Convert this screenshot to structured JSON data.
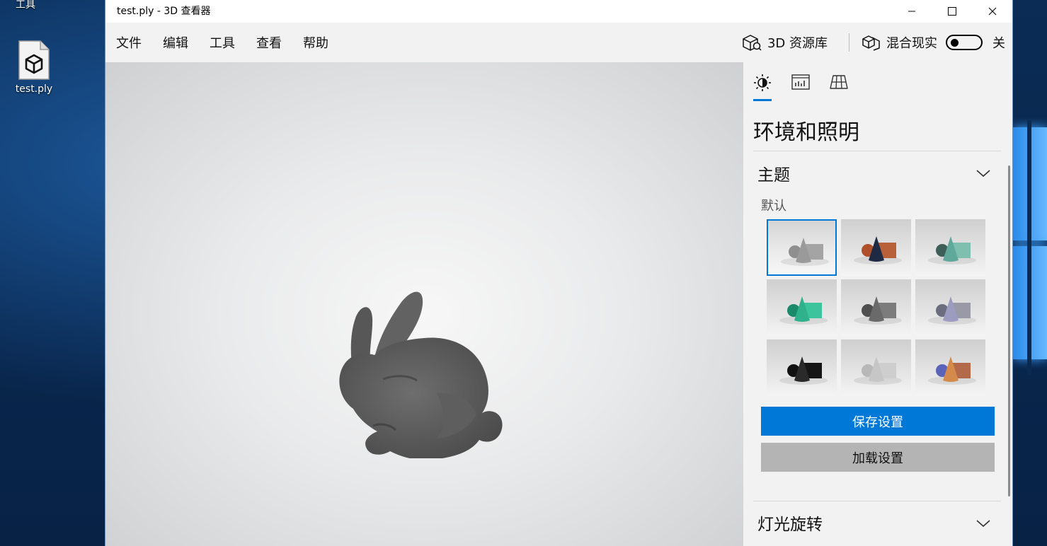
{
  "desktop": {
    "top_label": "工具",
    "file_icon_label": "test.ply"
  },
  "window": {
    "title": "test.ply - 3D 查看器",
    "controls": [
      "minimize",
      "maximize",
      "close"
    ]
  },
  "menubar": {
    "items": [
      "文件",
      "编辑",
      "工具",
      "查看",
      "帮助"
    ],
    "library_label": "3D 资源库",
    "mixed_reality_label": "混合现实",
    "toggle_state": "关"
  },
  "panel": {
    "tabs": [
      "environment-lighting-icon",
      "stats-icon",
      "grid-icon"
    ],
    "title": "环境和照明",
    "theme_section": {
      "heading": "主题",
      "selected_label": "默认",
      "themes": [
        {
          "sphere": "#8f8f8f",
          "cone": "#9a9a9a",
          "box": "#a4a4a4",
          "selected": true
        },
        {
          "sphere": "#b0502a",
          "cone": "#1e2a44",
          "box": "#b8603a",
          "selected": false
        },
        {
          "sphere": "#3d5f57",
          "cone": "#5fa89a",
          "box": "#7fbfb0",
          "selected": false
        },
        {
          "sphere": "#1b8a6a",
          "cone": "#2fb28c",
          "box": "#3cc49c",
          "selected": false
        },
        {
          "sphere": "#4f4f4f",
          "cone": "#6a6a6a",
          "box": "#7c7c7c",
          "selected": false
        },
        {
          "sphere": "#6d6d80",
          "cone": "#9c9cc0",
          "box": "#9a9aa6",
          "selected": false
        },
        {
          "sphere": "#111111",
          "cone": "#2a2a2a",
          "box": "#151515",
          "selected": false
        },
        {
          "sphere": "#b8b8b8",
          "cone": "#c6c6c6",
          "box": "#cecece",
          "selected": false
        },
        {
          "sphere": "#5a63b8",
          "cone": "#d48a4a",
          "box": "#b26a4a",
          "selected": false
        }
      ]
    },
    "save_button": "保存设置",
    "load_button": "加载设置",
    "light_rotation_section": {
      "heading": "灯光旋转"
    }
  },
  "colors": {
    "accent": "#0078d7",
    "model": "#5a5a5a"
  }
}
